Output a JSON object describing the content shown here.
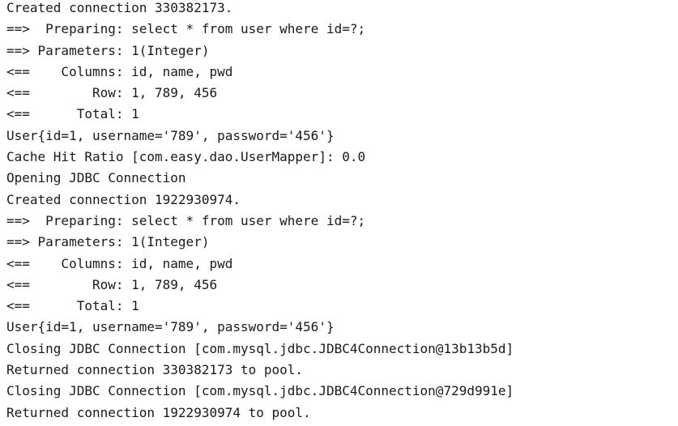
{
  "console": {
    "lines": [
      "Created connection 330382173.",
      "==>  Preparing: select * from user where id=?;",
      "==> Parameters: 1(Integer)",
      "<==    Columns: id, name, pwd",
      "<==        Row: 1, 789, 456",
      "<==      Total: 1",
      "User{id=1, username='789', password='456'}",
      "Cache Hit Ratio [com.easy.dao.UserMapper]: 0.0",
      "Opening JDBC Connection",
      "Created connection 1922930974.",
      "==>  Preparing: select * from user where id=?;",
      "==> Parameters: 1(Integer)",
      "<==    Columns: id, name, pwd",
      "<==        Row: 1, 789, 456",
      "<==      Total: 1",
      "User{id=1, username='789', password='456'}",
      "Closing JDBC Connection [com.mysql.jdbc.JDBC4Connection@13b13b5d]",
      "Returned connection 330382173 to pool.",
      "Closing JDBC Connection [com.mysql.jdbc.JDBC4Connection@729d991e]",
      "Returned connection 1922930974 to pool."
    ]
  }
}
